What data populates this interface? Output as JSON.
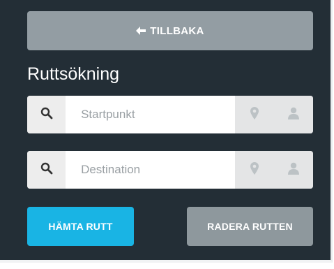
{
  "back_button": {
    "label": "TILLBAKA",
    "icon": "arrow-left-icon"
  },
  "title": "Ruttsökning",
  "start_field": {
    "placeholder": "Startpunkt",
    "value": "",
    "search_icon": "search-icon",
    "location_icon": "map-pin-icon",
    "user_icon": "user-icon"
  },
  "destination_field": {
    "placeholder": "Destination",
    "value": "",
    "search_icon": "search-icon",
    "location_icon": "map-pin-icon",
    "user_icon": "user-icon"
  },
  "actions": {
    "fetch_label": "HÄMTA RUTT",
    "clear_label": "RADERA RUTTEN"
  },
  "colors": {
    "panel_bg": "#232e36",
    "back_button_bg": "#939da3",
    "fetch_button_bg": "#19b4e4",
    "clear_button_bg": "#8e989d",
    "icon_muted": "#bcc2c5",
    "search_icon": "#333333"
  }
}
